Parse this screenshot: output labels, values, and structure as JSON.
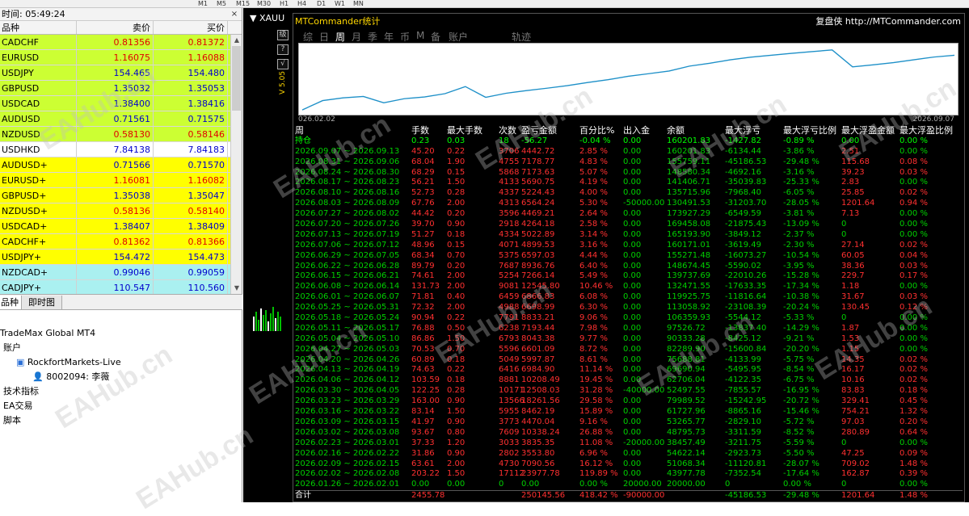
{
  "toolbar": {
    "items": [
      "M1",
      "M5",
      "M15",
      "M30",
      "H1",
      "H4",
      "D1",
      "W1",
      "MN"
    ]
  },
  "market_watch": {
    "time": "时间: 05:49:24",
    "columns": {
      "symbol": "品种",
      "bid": "卖价",
      "ask": "买价"
    },
    "rows": [
      {
        "symbol": "CADCHF",
        "bid": "0.81356",
        "ask": "0.81372",
        "bg": "#ccff33",
        "fg": "#e00000"
      },
      {
        "symbol": "EURUSD",
        "bid": "1.16075",
        "ask": "1.16088",
        "bg": "#ccff33",
        "fg": "#e00000"
      },
      {
        "symbol": "USDJPY",
        "bid": "154.465",
        "ask": "154.480",
        "bg": "#ccff33",
        "fg": "#0000cc"
      },
      {
        "symbol": "GBPUSD",
        "bid": "1.35032",
        "ask": "1.35053",
        "bg": "#ccff33",
        "fg": "#0000cc"
      },
      {
        "symbol": "USDCAD",
        "bid": "1.38400",
        "ask": "1.38416",
        "bg": "#ccff33",
        "fg": "#0000cc"
      },
      {
        "symbol": "AUDUSD",
        "bid": "0.71561",
        "ask": "0.71575",
        "bg": "#ccff33",
        "fg": "#0000cc"
      },
      {
        "symbol": "NZDUSD",
        "bid": "0.58130",
        "ask": "0.58146",
        "bg": "#ccff33",
        "fg": "#e00000"
      },
      {
        "symbol": "USDHKD",
        "bid": "7.84138",
        "ask": "7.84183",
        "bg": "#ffffff",
        "fg": "#0000cc"
      },
      {
        "symbol": "AUDUSD+",
        "bid": "0.71566",
        "ask": "0.71570",
        "bg": "#ffff00",
        "fg": "#0000cc"
      },
      {
        "symbol": "EURUSD+",
        "bid": "1.16081",
        "ask": "1.16082",
        "bg": "#ffff00",
        "fg": "#e00000"
      },
      {
        "symbol": "GBPUSD+",
        "bid": "1.35038",
        "ask": "1.35047",
        "bg": "#ffff00",
        "fg": "#0000cc"
      },
      {
        "symbol": "NZDUSD+",
        "bid": "0.58136",
        "ask": "0.58140",
        "bg": "#ffff00",
        "fg": "#e00000"
      },
      {
        "symbol": "USDCAD+",
        "bid": "1.38407",
        "ask": "1.38409",
        "bg": "#ffff00",
        "fg": "#0000cc"
      },
      {
        "symbol": "CADCHF+",
        "bid": "0.81362",
        "ask": "0.81366",
        "bg": "#ffff00",
        "fg": "#e00000"
      },
      {
        "symbol": "USDJPY+",
        "bid": "154.472",
        "ask": "154.473",
        "bg": "#ffff00",
        "fg": "#0000cc"
      },
      {
        "symbol": "NZDCAD+",
        "bid": "0.99046",
        "ask": "0.99059",
        "bg": "#aaf0f0",
        "fg": "#0000cc"
      },
      {
        "symbol": "CADJPY+",
        "bid": "110.547",
        "ask": "110.560",
        "bg": "#aaf0f0",
        "fg": "#0000cc"
      }
    ],
    "tabs": [
      "品种",
      "即时图"
    ]
  },
  "navigator": {
    "items": [
      {
        "label": "TradeMax Global MT4",
        "indent": 0
      },
      {
        "label": "账户",
        "indent": 4
      },
      {
        "label": "RockfortMarkets-Live",
        "indent": 20
      },
      {
        "label": "8002094: 李薇",
        "indent": 40
      },
      {
        "label": "技术指标",
        "indent": 4
      },
      {
        "label": "EA交易",
        "indent": 4
      },
      {
        "label": "脚本",
        "indent": 4
      }
    ]
  },
  "chart": {
    "title": "XAUU"
  },
  "panel": {
    "title": "MTCommander统计",
    "site": "复盘侠 http://MTCommander.com",
    "close": "×",
    "tabs": [
      {
        "label": "综",
        "selected": false
      },
      {
        "label": "日",
        "selected": false
      },
      {
        "label": "周",
        "selected": true
      },
      {
        "label": "月",
        "selected": false
      },
      {
        "label": "季",
        "selected": false
      },
      {
        "label": "年",
        "selected": false
      },
      {
        "label": "币",
        "selected": false
      },
      {
        "label": "M",
        "selected": false
      },
      {
        "label": "备",
        "selected": false
      },
      {
        "label": "账户",
        "selected": false
      },
      {
        "label": "轨迹",
        "selected": false
      }
    ],
    "side_buttons": [
      "级",
      "?",
      "√"
    ],
    "side_label": "V 5.05",
    "graph": {
      "start_label": "026.02.02",
      "end_label": "2026.09.07",
      "balance": [
        20000,
        43977.78,
        51068.34,
        54622.14,
        38457.49,
        48795.73,
        53265.77,
        61727.96,
        79989.52,
        52497.55,
        62706.04,
        69690.94,
        75688.81,
        82289.9,
        90333.28,
        97526.72,
        106359.93,
        113058.92,
        119925.75,
        132471.55,
        139737.69,
        148674.45,
        155271.48,
        160171.01,
        165193.9,
        169458.08,
        173927.29,
        130491.53,
        135715.96,
        141406.71,
        148580.34,
        155759.11,
        160201.83
      ]
    },
    "columns": [
      "周",
      "手数",
      "最大手数",
      "次数",
      "盈亏金额",
      "百分比%",
      "出入金",
      "余额",
      "最大浮亏",
      "最大浮亏比例",
      "最大浮盈金额",
      "最大浮盈比例"
    ],
    "holding": [
      "持仓",
      "0.23",
      "0.03",
      "18",
      "-56.27",
      "-0.04 %",
      "0.00",
      "160201.83",
      "-1427.82",
      "-0.89 %",
      "0.00",
      "0.00 %"
    ],
    "rows": [
      [
        "2026.09.07 ~ 2026.09.13",
        "45.20",
        "0.22",
        "3706",
        "4442.72",
        "2.85 %",
        "0.00",
        "160201.83",
        "-6134.44",
        "-3.86 %",
        "2.51",
        "0.00 %"
      ],
      [
        "2026.08.31 ~ 2026.09.06",
        "68.04",
        "1.90",
        "4755",
        "7178.77",
        "4.83 %",
        "0.00",
        "155759.11",
        "-45186.53",
        "-29.48 %",
        "115.68",
        "0.08 %"
      ],
      [
        "2026.08.24 ~ 2026.08.30",
        "68.29",
        "0.15",
        "5868",
        "7173.63",
        "5.07 %",
        "0.00",
        "148580.34",
        "-4692.16",
        "-3.16 %",
        "39.23",
        "0.03 %"
      ],
      [
        "2026.08.17 ~ 2026.08.23",
        "56.21",
        "1.50",
        "4133",
        "5690.75",
        "4.19 %",
        "0.00",
        "141406.71",
        "-35039.83",
        "-25.33 %",
        "2.83",
        "0.00 %"
      ],
      [
        "2026.08.10 ~ 2026.08.16",
        "52.73",
        "0.28",
        "4337",
        "5224.43",
        "4.00 %",
        "0.00",
        "135715.96",
        "-7968.40",
        "-6.05 %",
        "25.85",
        "0.02 %"
      ],
      [
        "2026.08.03 ~ 2026.08.09",
        "67.76",
        "2.00",
        "4313",
        "6564.24",
        "5.30 %",
        "-50000.00",
        "130491.53",
        "-31203.70",
        "-28.05 %",
        "1201.64",
        "0.94 %"
      ],
      [
        "2026.07.27 ~ 2026.08.02",
        "44.42",
        "0.20",
        "3596",
        "4469.21",
        "2.64 %",
        "0.00",
        "173927.29",
        "-6549.59",
        "-3.81 %",
        "7.13",
        "0.00 %"
      ],
      [
        "2026.07.20 ~ 2026.07.26",
        "39.70",
        "0.90",
        "2918",
        "4264.18",
        "2.58 %",
        "0.00",
        "169458.08",
        "-21875.43",
        "-13.09 %",
        "0",
        "0.00 %"
      ],
      [
        "2026.07.13 ~ 2026.07.19",
        "51.27",
        "0.18",
        "4334",
        "5022.89",
        "3.14 %",
        "0.00",
        "165193.90",
        "-3849.12",
        "-2.37 %",
        "0",
        "0.00 %"
      ],
      [
        "2026.07.06 ~ 2026.07.12",
        "48.96",
        "0.15",
        "4071",
        "4899.53",
        "3.16 %",
        "0.00",
        "160171.01",
        "-3619.49",
        "-2.30 %",
        "27.14",
        "0.02 %"
      ],
      [
        "2026.06.29 ~ 2026.07.05",
        "68.34",
        "0.70",
        "5375",
        "6597.03",
        "4.44 %",
        "0.00",
        "155271.48",
        "-16073.27",
        "-10.54 %",
        "60.05",
        "0.04 %"
      ],
      [
        "2026.06.22 ~ 2026.06.28",
        "89.79",
        "0.20",
        "7687",
        "8936.76",
        "6.40 %",
        "0.00",
        "148674.45",
        "-5590.02",
        "-3.95 %",
        "38.36",
        "0.03 %"
      ],
      [
        "2026.06.15 ~ 2026.06.21",
        "74.61",
        "2.00",
        "5254",
        "7266.14",
        "5.49 %",
        "0.00",
        "139737.69",
        "-22010.26",
        "-15.28 %",
        "229.7",
        "0.17 %"
      ],
      [
        "2026.06.08 ~ 2026.06.14",
        "131.73",
        "2.00",
        "9081",
        "12545.80",
        "10.46 %",
        "0.00",
        "132471.55",
        "-17633.35",
        "-17.34 %",
        "1.18",
        "0.00 %"
      ],
      [
        "2026.06.01 ~ 2026.06.07",
        "71.81",
        "0.40",
        "6459",
        "6866.83",
        "6.08 %",
        "0.00",
        "119925.75",
        "-11816.64",
        "-10.38 %",
        "31.67",
        "0.03 %"
      ],
      [
        "2026.05.25 ~ 2026.05.31",
        "72.32",
        "2.00",
        "4988",
        "6698.99",
        "6.30 %",
        "0.00",
        "113058.92",
        "-23108.39",
        "-20.24 %",
        "130.45",
        "0.12 %"
      ],
      [
        "2026.05.18 ~ 2026.05.24",
        "90.94",
        "0.22",
        "7791",
        "8833.21",
        "9.06 %",
        "0.00",
        "106359.93",
        "-5544.12",
        "-5.33 %",
        "0",
        "0.00 %"
      ],
      [
        "2026.05.11 ~ 2026.05.17",
        "76.88",
        "0.50",
        "6238",
        "7193.44",
        "7.98 %",
        "0.00",
        "97526.72",
        "-13837.40",
        "-14.29 %",
        "1.87",
        "0.00 %"
      ],
      [
        "2026.05.04 ~ 2026.05.10",
        "86.86",
        "1.50",
        "6793",
        "8043.38",
        "9.77 %",
        "0.00",
        "90333.28",
        "-8425.12",
        "-9.21 %",
        "1.53",
        "0.00 %"
      ],
      [
        "2026.04.27 ~ 2026.05.03",
        "70.53",
        "0.70",
        "5596",
        "6601.09",
        "8.72 %",
        "0.00",
        "82289.90",
        "-15600.84",
        "-20.20 %",
        "1.15",
        "0.00 %"
      ],
      [
        "2026.04.20 ~ 2026.04.26",
        "60.89",
        "0.18",
        "5049",
        "5997.87",
        "8.61 %",
        "0.00",
        "75688.81",
        "-4133.99",
        "-5.75 %",
        "14.35",
        "0.02 %"
      ],
      [
        "2026.04.13 ~ 2026.04.19",
        "74.63",
        "0.22",
        "6416",
        "6984.90",
        "11.14 %",
        "0.00",
        "69690.94",
        "-5495.95",
        "-8.54 %",
        "16.17",
        "0.02 %"
      ],
      [
        "2026.04.06 ~ 2026.04.12",
        "103.59",
        "0.18",
        "8881",
        "10208.49",
        "19.45 %",
        "0.00",
        "62706.04",
        "-4122.35",
        "-6.75 %",
        "10.16",
        "0.02 %"
      ],
      [
        "2026.03.30 ~ 2026.04.05",
        "122.25",
        "0.28",
        "10171",
        "12508.03",
        "31.28 %",
        "-40000.00",
        "52497.55",
        "-7855.57",
        "-16.95 %",
        "83.83",
        "0.18 %"
      ],
      [
        "2026.03.23 ~ 2026.03.29",
        "163.00",
        "0.90",
        "13566",
        "18261.56",
        "29.58 %",
        "0.00",
        "79989.52",
        "-15242.95",
        "-20.72 %",
        "329.41",
        "0.45 %"
      ],
      [
        "2026.03.16 ~ 2026.03.22",
        "83.14",
        "1.50",
        "5955",
        "8462.19",
        "15.89 %",
        "0.00",
        "61727.96",
        "-8865.16",
        "-15.46 %",
        "754.21",
        "1.32 %"
      ],
      [
        "2026.03.09 ~ 2026.03.15",
        "41.97",
        "0.90",
        "3773",
        "4470.04",
        "9.16 %",
        "0.00",
        "53265.77",
        "-2829.10",
        "-5.72 %",
        "97.03",
        "0.20 %"
      ],
      [
        "2026.03.02 ~ 2026.03.08",
        "93.67",
        "0.80",
        "7609",
        "10338.24",
        "26.88 %",
        "0.00",
        "48795.73",
        "-3311.59",
        "-8.52 %",
        "280.89",
        "0.64 %"
      ],
      [
        "2026.02.23 ~ 2026.03.01",
        "37.33",
        "1.20",
        "3033",
        "3835.35",
        "11.08 %",
        "-20000.00",
        "38457.49",
        "-3211.75",
        "-5.59 %",
        "0",
        "0.00 %"
      ],
      [
        "2026.02.16 ~ 2026.02.22",
        "31.86",
        "0.90",
        "2802",
        "3553.80",
        "6.96 %",
        "0.00",
        "54622.14",
        "-2923.73",
        "-5.50 %",
        "47.25",
        "0.09 %"
      ],
      [
        "2026.02.09 ~ 2026.02.15",
        "63.61",
        "2.00",
        "4730",
        "7090.56",
        "16.12 %",
        "0.00",
        "51068.34",
        "-11120.81",
        "-28.07 %",
        "709.02",
        "1.48 %"
      ],
      [
        "2026.02.02 ~ 2026.02.08",
        "203.22",
        "1.50",
        "17112",
        "23977.78",
        "119.89 %",
        "0.00",
        "43977.78",
        "-7352.54",
        "-17.64 %",
        "162.87",
        "0.39 %"
      ],
      [
        "2026.01.26 ~ 2026.02.01",
        "0.00",
        "0.00",
        "0",
        "0.00",
        "0.00 %",
        "20000.00",
        "20000.00",
        "0",
        "0.00 %",
        "0",
        "0.00 %"
      ]
    ],
    "total": [
      "合计",
      "2455.78",
      "",
      "",
      "250145.56",
      "418.42 %",
      "-90000.00",
      "",
      "-45186.53",
      "-29.48 %",
      "1201.64",
      "1.48 %"
    ]
  },
  "watermark": "EAHub.cn"
}
